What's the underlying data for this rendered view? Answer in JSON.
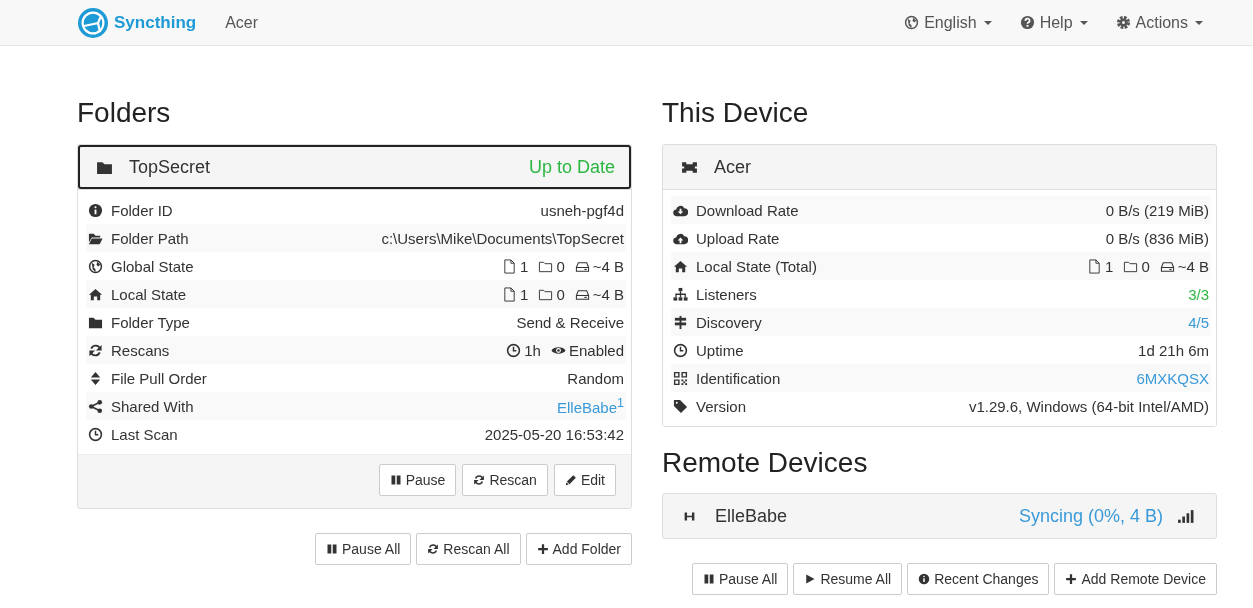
{
  "navbar": {
    "brand": "Syncthing",
    "device_name": "Acer",
    "menus": [
      {
        "label": "English"
      },
      {
        "label": "Help"
      },
      {
        "label": "Actions"
      }
    ]
  },
  "folders": {
    "heading": "Folders",
    "items": [
      {
        "name": "TopSecret",
        "status": "Up to Date",
        "color": "#2cb742",
        "focused": true,
        "rows": [
          {
            "label": "Folder ID",
            "kind": "text",
            "value": "usneh-pgf4d"
          },
          {
            "label": "Folder Path",
            "kind": "text",
            "value": "c:\\Users\\Mike\\Documents\\TopSecret"
          },
          {
            "label": "Global State",
            "kind": "counts",
            "files": "1",
            "folders": "0",
            "size": "~4 B"
          },
          {
            "label": "Local State",
            "kind": "counts",
            "files": "1",
            "folders": "0",
            "size": "~4 B"
          },
          {
            "label": "Folder Type",
            "kind": "text",
            "value": "Send & Receive"
          },
          {
            "label": "Rescans",
            "kind": "rescans",
            "interval": "1h",
            "watcher": "Enabled"
          },
          {
            "label": "File Pull Order",
            "kind": "text",
            "value": "Random"
          },
          {
            "label": "Shared With",
            "kind": "link",
            "value": "ElleBabe$^{1}$"
          },
          {
            "label": "Last Scan",
            "kind": "text",
            "value": "2025-05-20 16:53:42"
          }
        ],
        "buttons": [
          "Pause",
          "Rescan",
          "Edit"
        ]
      }
    ],
    "buttons": [
      "Pause All",
      "Rescan All",
      "Add Folder"
    ]
  },
  "this_device": {
    "heading": "This Device",
    "name": "Acer",
    "rows": [
      {
        "label": "Download Rate",
        "kind": "text",
        "value": "0 B/s (219 MiB)"
      },
      {
        "label": "Upload Rate",
        "kind": "text",
        "value": "0 B/s (836 MiB)"
      },
      {
        "label": "Local State (Total)",
        "kind": "counts",
        "files": "1",
        "folders": "0",
        "size": "~4 B"
      },
      {
        "label": "Listeners",
        "kind": "good",
        "value": "3/3"
      },
      {
        "label": "Discovery",
        "kind": "link",
        "value": "4/5"
      },
      {
        "label": "Uptime",
        "kind": "text",
        "value": "1d 21h 6m"
      },
      {
        "label": "Identification",
        "kind": "link",
        "value": "6MXKQSX"
      },
      {
        "label": "Version",
        "kind": "text",
        "value": "v1.29.6, Windows (64-bit Intel/AMD)"
      }
    ]
  },
  "remote_devices": {
    "heading": "Remote Devices",
    "items": [
      {
        "name": "ElleBabe",
        "status": "Syncing (0%, 4 B)",
        "color": "#3a9ad9"
      }
    ],
    "buttons": [
      "Pause All",
      "Resume All",
      "Recent Changes",
      "Add Remote Device"
    ]
  }
}
